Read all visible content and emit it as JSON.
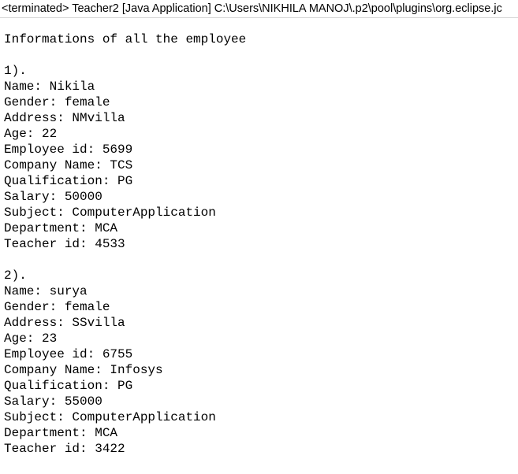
{
  "console": {
    "header": "<terminated> Teacher2 [Java Application] C:\\Users\\NIKHILA MANOJ\\.p2\\pool\\plugins\\org.eclipse.jc",
    "title_line": "Informations of all the employee",
    "records": [
      {
        "index": "1).",
        "name": "Name: Nikila",
        "gender": "Gender: female",
        "address": "Address: NMvilla",
        "age": "Age: 22",
        "employee_id": "Employee id: 5699",
        "company": "Company Name: TCS",
        "qualification": "Qualification: PG",
        "salary": "Salary: 50000",
        "subject": "Subject: ComputerApplication",
        "department": "Department: MCA",
        "teacher_id": "Teacher id: 4533"
      },
      {
        "index": "2).",
        "name": "Name: surya",
        "gender": "Gender: female",
        "address": "Address: SSvilla",
        "age": "Age: 23",
        "employee_id": "Employee id: 6755",
        "company": "Company Name: Infosys",
        "qualification": "Qualification: PG",
        "salary": "Salary: 55000",
        "subject": "Subject: ComputerApplication",
        "department": "Department: MCA",
        "teacher_id": "Teacher id: 3422"
      }
    ]
  }
}
